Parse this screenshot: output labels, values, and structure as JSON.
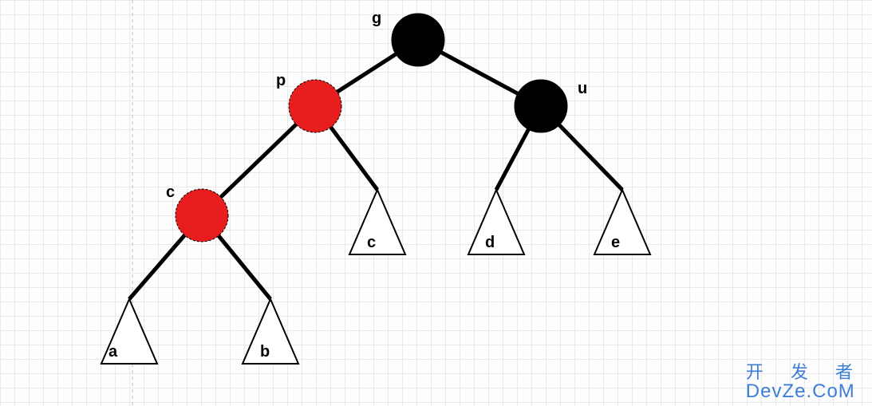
{
  "diagram": {
    "type": "tree",
    "description": "Red-black tree rotation case diagram",
    "nodes": {
      "g": {
        "label": "g",
        "color": "black"
      },
      "p": {
        "label": "p",
        "color": "red"
      },
      "u": {
        "label": "u",
        "color": "black"
      },
      "c": {
        "label": "c",
        "color": "red"
      }
    },
    "subtrees": {
      "a": {
        "label": "a"
      },
      "b": {
        "label": "b"
      },
      "c": {
        "label": "c"
      },
      "d": {
        "label": "d"
      },
      "e": {
        "label": "e"
      }
    },
    "edges": [
      [
        "g",
        "p"
      ],
      [
        "g",
        "u"
      ],
      [
        "p",
        "c"
      ],
      [
        "p",
        "subtree_c"
      ],
      [
        "u",
        "subtree_d"
      ],
      [
        "u",
        "subtree_e"
      ],
      [
        "c",
        "subtree_a"
      ],
      [
        "c",
        "subtree_b"
      ]
    ],
    "colors": {
      "black_node": "#000000",
      "red_node": "#e81e1e"
    }
  },
  "watermark": {
    "line1": "开 发 者",
    "line2": "DevZe.CoM"
  }
}
